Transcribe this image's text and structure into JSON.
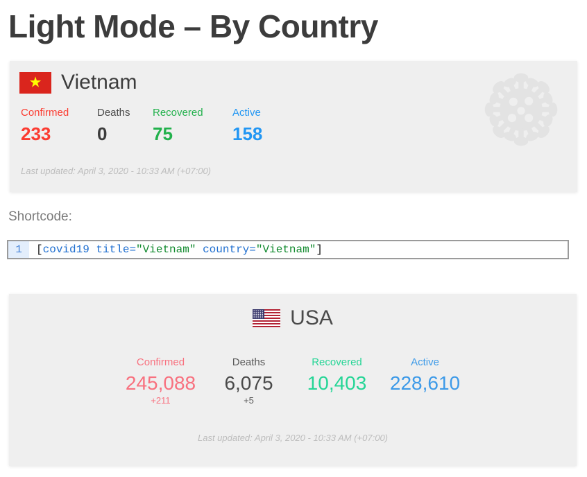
{
  "page": {
    "title": "Light Mode – By Country"
  },
  "cards": [
    {
      "id": "vietnam",
      "country": "Vietnam",
      "flag_icon": "vietnam-flag-icon",
      "decor_icon": "coronavirus-icon",
      "stats": [
        {
          "key": "confirmed",
          "label": "Confirmed",
          "value": "233",
          "delta": ""
        },
        {
          "key": "deaths",
          "label": "Deaths",
          "value": "0",
          "delta": ""
        },
        {
          "key": "recovered",
          "label": "Recovered",
          "value": "75",
          "delta": ""
        },
        {
          "key": "active",
          "label": "Active",
          "value": "158",
          "delta": ""
        }
      ],
      "last_updated": "Last updated: April 3, 2020 - 10:33 AM (+07:00)"
    },
    {
      "id": "usa",
      "country": "USA",
      "flag_icon": "usa-flag-icon",
      "stats": [
        {
          "key": "confirmed",
          "label": "Confirmed",
          "value": "245,088",
          "delta": "+211"
        },
        {
          "key": "deaths",
          "label": "Deaths",
          "value": "6,075",
          "delta": "+5"
        },
        {
          "key": "recovered",
          "label": "Recovered",
          "value": "10,403",
          "delta": ""
        },
        {
          "key": "active",
          "label": "Active",
          "value": "228,610",
          "delta": ""
        }
      ],
      "last_updated": "Last updated: April 3, 2020 - 10:33 AM (+07:00)"
    }
  ],
  "shortcode": {
    "label": "Shortcode:",
    "line_number": "1",
    "tokens": {
      "open_bracket": "[",
      "tag": "covid19",
      "attr_title": " title=",
      "value_title": "\"Vietnam\"",
      "attr_country": " country=",
      "value_country": "\"Vietnam\"",
      "close_bracket": "]"
    },
    "full_text": "[covid19 title=\"Vietnam\" country=\"Vietnam\"]"
  },
  "colors": {
    "confirmed_strong": "#fb3b30",
    "deaths_strong": "#3c3c3c",
    "recovered_strong": "#22b14c",
    "active_strong": "#2196f3",
    "confirmed_light": "#f8717f",
    "recovered_light": "#25d596",
    "active_light": "#3d9ae8",
    "card_bg": "#efefef",
    "muted_text": "#bdbdbd"
  }
}
